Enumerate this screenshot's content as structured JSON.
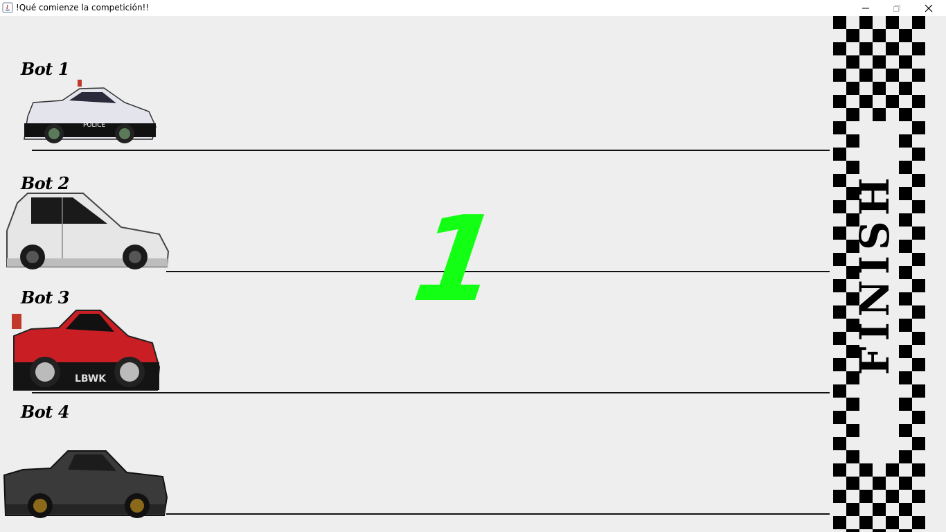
{
  "window": {
    "title": "!Qué comienze la competición!!"
  },
  "race": {
    "countdown": "1",
    "countdown_color": "#13ff13",
    "finish_text": "FINISH",
    "lanes": [
      {
        "label": "Bot 1",
        "car": "police-car-icon"
      },
      {
        "label": "Bot 2",
        "car": "white-hatchback-icon"
      },
      {
        "label": "Bot 3",
        "car": "red-race-car-icon"
      },
      {
        "label": "Bot 4",
        "car": "black-muscle-car-icon"
      }
    ]
  }
}
